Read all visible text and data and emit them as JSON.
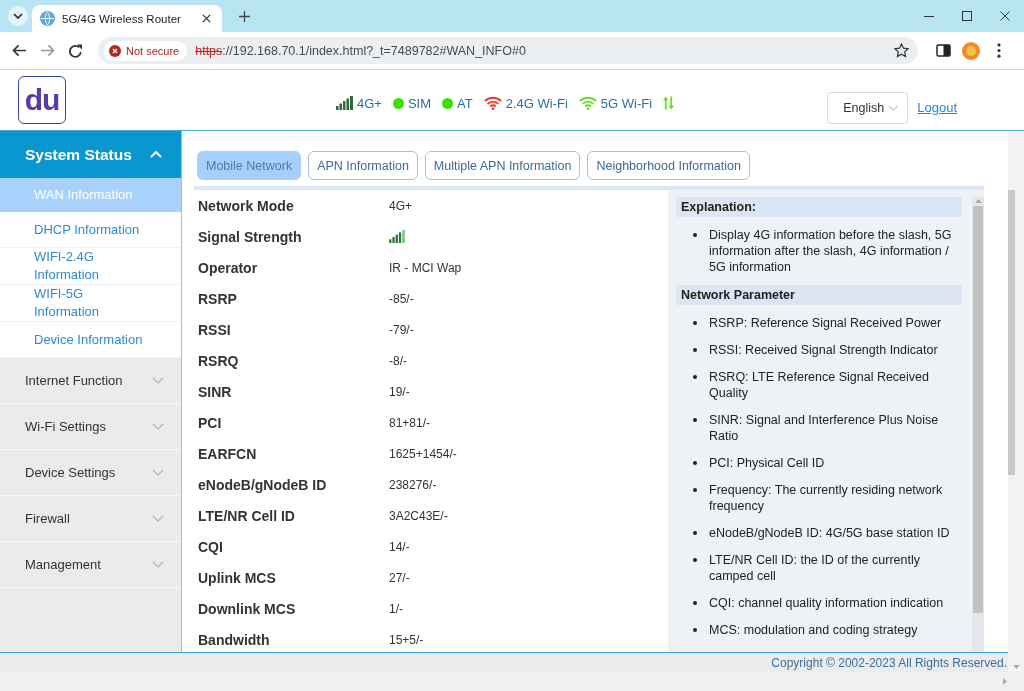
{
  "browser": {
    "tab_title": "5G/4G Wireless Router",
    "security_label": "Not secure",
    "url": {
      "scheme": "https",
      "rest": "://192.168.70.1/index.html?_t=7489782#WAN_INFO#0"
    }
  },
  "header": {
    "logo": "du",
    "status": [
      {
        "kind": "signal",
        "label": "4G+",
        "color": "#2d6a3e"
      },
      {
        "kind": "dot",
        "label": "SIM",
        "color": "#3be000"
      },
      {
        "kind": "dot",
        "label": "AT",
        "color": "#3be000"
      },
      {
        "kind": "wifi",
        "label": "2.4G Wi-Fi",
        "color": "#f0362a"
      },
      {
        "kind": "wifi",
        "label": "5G Wi-Fi",
        "color": "#6bdc2a"
      },
      {
        "kind": "arrows",
        "color": "#6bdc2a"
      }
    ],
    "language": "English",
    "logout": "Logout"
  },
  "sidebar": {
    "groups": [
      {
        "label": "System Status",
        "expanded": true,
        "children": [
          {
            "label": "WAN Information",
            "selected": true
          },
          {
            "label": "DHCP Information",
            "selected": false
          },
          {
            "label": "WIFI-2.4G Information",
            "selected": false
          },
          {
            "label": "WIFI-5G Information",
            "selected": false
          },
          {
            "label": "Device Information",
            "selected": false
          }
        ]
      },
      {
        "label": "Internet Function",
        "expanded": false
      },
      {
        "label": "Wi-Fi Settings",
        "expanded": false
      },
      {
        "label": "Device Settings",
        "expanded": false
      },
      {
        "label": "Firewall",
        "expanded": false
      },
      {
        "label": "Management",
        "expanded": false
      }
    ]
  },
  "tabs": [
    {
      "label": "Mobile Network",
      "selected": true
    },
    {
      "label": "APN Information",
      "selected": false
    },
    {
      "label": "Multiple APN Information",
      "selected": false
    },
    {
      "label": "Neighborhood Information",
      "selected": false
    }
  ],
  "table": {
    "rows": [
      {
        "kind": "text",
        "label": "Network Mode",
        "value": "4G+"
      },
      {
        "kind": "signal",
        "label": "Signal Strength"
      },
      {
        "kind": "text",
        "label": "Operator",
        "value": "IR - MCI Wap"
      },
      {
        "kind": "text",
        "label": "RSRP",
        "value": "-85/-"
      },
      {
        "kind": "text",
        "label": "RSSI",
        "value": "-79/-"
      },
      {
        "kind": "text",
        "label": "RSRQ",
        "value": "-8/-"
      },
      {
        "kind": "text",
        "label": "SINR",
        "value": "19/-"
      },
      {
        "kind": "text",
        "label": "PCI",
        "value": "81+81/-"
      },
      {
        "kind": "text",
        "label": "EARFCN",
        "value": "1625+1454/-"
      },
      {
        "kind": "text",
        "label": "eNodeB/gNodeB ID",
        "value": "238276/-"
      },
      {
        "kind": "text",
        "label": "LTE/NR Cell ID",
        "value": "3A2C43E/-"
      },
      {
        "kind": "text",
        "label": "CQI",
        "value": "14/-"
      },
      {
        "kind": "text",
        "label": "Uplink MCS",
        "value": "27/-"
      },
      {
        "kind": "text",
        "label": "Downlink MCS",
        "value": "1/-"
      },
      {
        "kind": "text",
        "label": "Bandwidth",
        "value": "15+5/-"
      }
    ]
  },
  "explanation": {
    "sections": [
      {
        "title": "Explanation:",
        "items": [
          "Display 4G information before the slash, 5G information after the slash, 4G information / 5G information"
        ]
      },
      {
        "title": "Network Parameter",
        "items": [
          "RSRP: Reference Signal Received Power",
          "RSSI: Received Signal Strength Indicator",
          "RSRQ: LTE Reference Signal Received Quality",
          "SINR: Signal and Interference Plus Noise Ratio",
          "PCI: Physical Cell ID",
          "Frequency: The currently residing network frequency",
          "eNodeB/gNodeB ID: 4G/5G base station ID",
          "LTE/NR Cell ID: the ID of the currently camped cell",
          "CQI: channel quality information indication",
          "MCS: modulation and coding strategy"
        ]
      }
    ]
  },
  "footer": {
    "copyright": "Copyright © 2002-2023 All Rights Reserved."
  }
}
